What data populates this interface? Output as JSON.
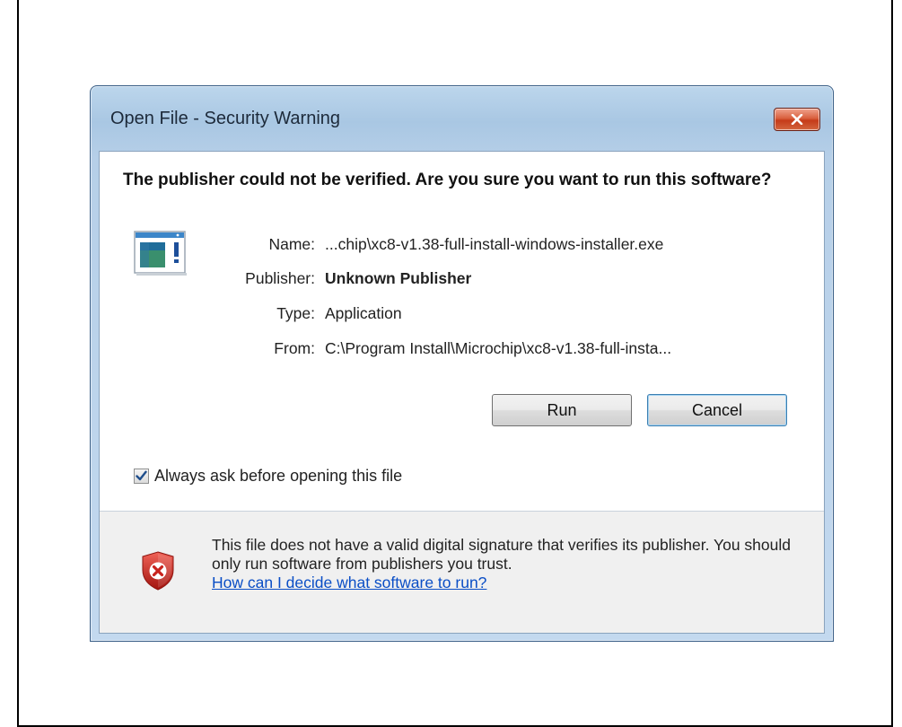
{
  "dialog": {
    "title": "Open File - Security Warning",
    "heading": "The publisher could not be verified.  Are you sure you want to run this software?",
    "fields": [
      {
        "label": "Name:",
        "value": "...chip\\xc8-v1.38-full-install-windows-installer.exe",
        "bold": false
      },
      {
        "label": "Publisher:",
        "value": "Unknown Publisher",
        "bold": true
      },
      {
        "label": "Type:",
        "value": "Application",
        "bold": false
      },
      {
        "label": "From:",
        "value": "C:\\Program Install\\Microchip\\xc8-v1.38-full-insta...",
        "bold": false
      }
    ],
    "buttons": {
      "run": "Run",
      "cancel": "Cancel"
    },
    "checkbox": {
      "label": "Always ask before opening this file",
      "checked": true
    },
    "footer": {
      "text": "This file does not have a valid digital signature that verifies its publisher.  You should only run software from publishers you trust.",
      "link": "How can I decide what software to run?"
    }
  },
  "icons": {
    "close": "close-icon",
    "app": "application-icon",
    "shield": "shield-error-icon"
  },
  "colors": {
    "link": "#0a4ec6",
    "close_button": "#c53b19",
    "shield": "#c8231d"
  }
}
